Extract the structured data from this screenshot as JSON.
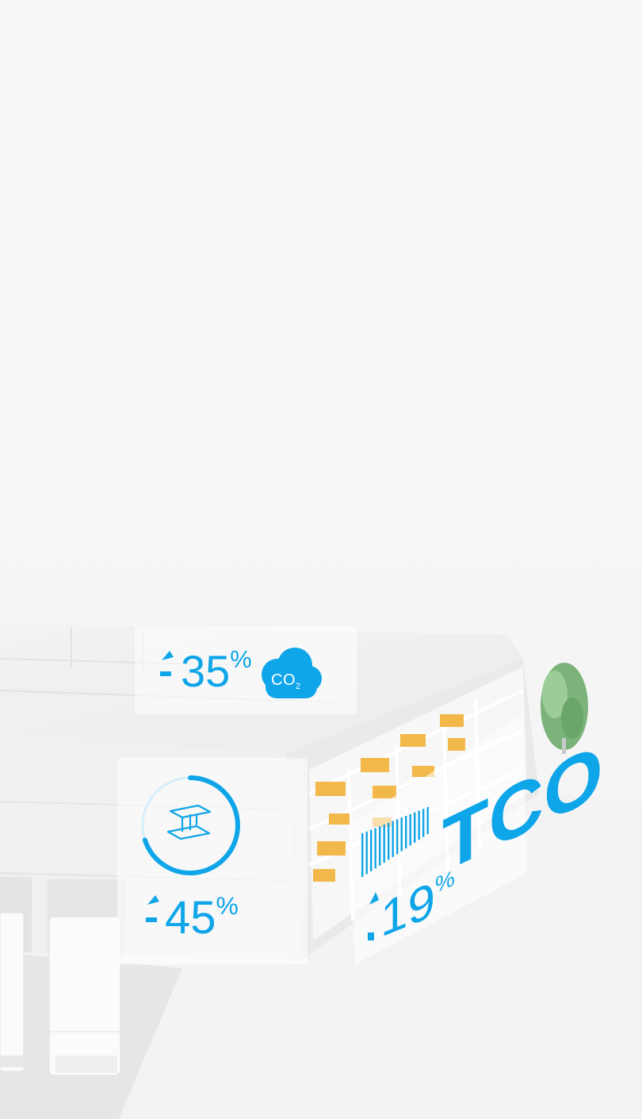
{
  "stats": {
    "co2_reduction": {
      "value": "35",
      "unit": "%",
      "icon": "co2-cloud-icon"
    },
    "co2_label": {
      "main": "CO",
      "sub": "2"
    },
    "steel_reduction": {
      "value": "45",
      "unit": "%",
      "icon": "steel-beam-icon",
      "progress": 0.7
    },
    "tco_reduction": {
      "value": "19",
      "unit": "%",
      "label": "TCO"
    }
  },
  "colors": {
    "accent": "#0ea5e9",
    "box": "#f2b84a",
    "tree": "#7bb37a",
    "background": "#f6f6f6"
  }
}
